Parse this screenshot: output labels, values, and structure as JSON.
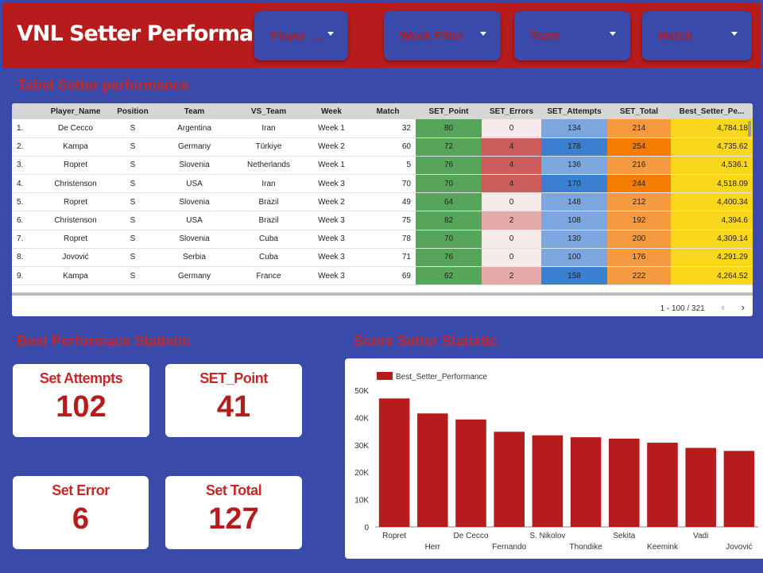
{
  "app": {
    "title": "VNL Setter Performance"
  },
  "filters": [
    {
      "label": "Player_..."
    },
    {
      "label": "Week Filter"
    },
    {
      "label": "Team"
    },
    {
      "label": "Match"
    }
  ],
  "table": {
    "title": "Tabel Setter performance",
    "columns": [
      "",
      "Player_Name",
      "Position",
      "Team",
      "VS_Team",
      "Week",
      "Match",
      "SET_Point",
      "SET_Errors",
      "SET_Attempts",
      "SET_Total",
      "Best_Setter_Pe..."
    ],
    "rows": [
      [
        "1.",
        "De Cecco",
        "S",
        "Argentina",
        "Iran",
        "Week 1",
        "32",
        "80",
        "0",
        "134",
        "214",
        "4,784.18"
      ],
      [
        "2.",
        "Kampa",
        "S",
        "Germany",
        "Türkiye",
        "Week 2",
        "60",
        "72",
        "4",
        "178",
        "254",
        "4,735.62"
      ],
      [
        "3.",
        "Ropret",
        "S",
        "Slovenia",
        "Netherlands",
        "Week 1",
        "5",
        "76",
        "4",
        "136",
        "216",
        "4,536.1"
      ],
      [
        "4.",
        "Christenson",
        "S",
        "USA",
        "Iran",
        "Week 3",
        "70",
        "70",
        "4",
        "170",
        "244",
        "4,518.09"
      ],
      [
        "5.",
        "Ropret",
        "S",
        "Slovenia",
        "Brazil",
        "Week 2",
        "49",
        "64",
        "0",
        "148",
        "212",
        "4,400.34"
      ],
      [
        "6.",
        "Christenson",
        "S",
        "USA",
        "Brazil",
        "Week 3",
        "75",
        "82",
        "2",
        "108",
        "192",
        "4,394.6"
      ],
      [
        "7.",
        "Ropret",
        "S",
        "Slovenia",
        "Cuba",
        "Week 3",
        "78",
        "70",
        "0",
        "130",
        "200",
        "4,309.14"
      ],
      [
        "8.",
        "Jovović",
        "S",
        "Serbia",
        "Cuba",
        "Week 3",
        "71",
        "76",
        "0",
        "100",
        "176",
        "4,291.29"
      ],
      [
        "9.",
        "Kampa",
        "S",
        "Germany",
        "France",
        "Week 3",
        "69",
        "62",
        "2",
        "158",
        "222",
        "4,264.52"
      ]
    ],
    "pager": "1 - 100 / 321",
    "colors": {
      "point": "#57a55a",
      "error_high": "#cd5c5c",
      "error_mid": "#e6a9a9",
      "error_low": "#f6e9e9",
      "attempts_high": "#3b7fd0",
      "attempts_low": "#7ba7de",
      "total_high": "#f57c00",
      "total_low": "#f59a3f",
      "best": "#f9d71c"
    }
  },
  "stats": {
    "title": "Best Performace Statistic",
    "set_attempts": {
      "label": "Set Attempts",
      "value": "102"
    },
    "set_point": {
      "label": "SET_Point",
      "value": "41"
    },
    "set_error": {
      "label": "Set Error",
      "value": "6"
    },
    "set_total": {
      "label": "Set Total",
      "value": "127"
    }
  },
  "chart_title": "Score Setter Statistic",
  "chart_data": {
    "type": "bar",
    "categories": [
      "Ropret",
      "Herr",
      "De Cecco",
      "Fernando",
      "S. Nikolov",
      "Thondike",
      "Sekita",
      "Keemink",
      "Vadi",
      "Jovović"
    ],
    "series": [
      {
        "name": "Best_Setter_Performance",
        "values": [
          47000,
          41500,
          39300,
          34800,
          33500,
          32800,
          32300,
          30800,
          28900,
          27800
        ]
      }
    ],
    "ylim": [
      0,
      50000
    ],
    "yticks": [
      0,
      10000,
      20000,
      30000,
      40000,
      50000
    ],
    "ytick_labels": [
      "0",
      "10K",
      "20K",
      "30K",
      "40K",
      "50K"
    ],
    "legend": "top-left",
    "bar_color": "#b71c1c"
  }
}
